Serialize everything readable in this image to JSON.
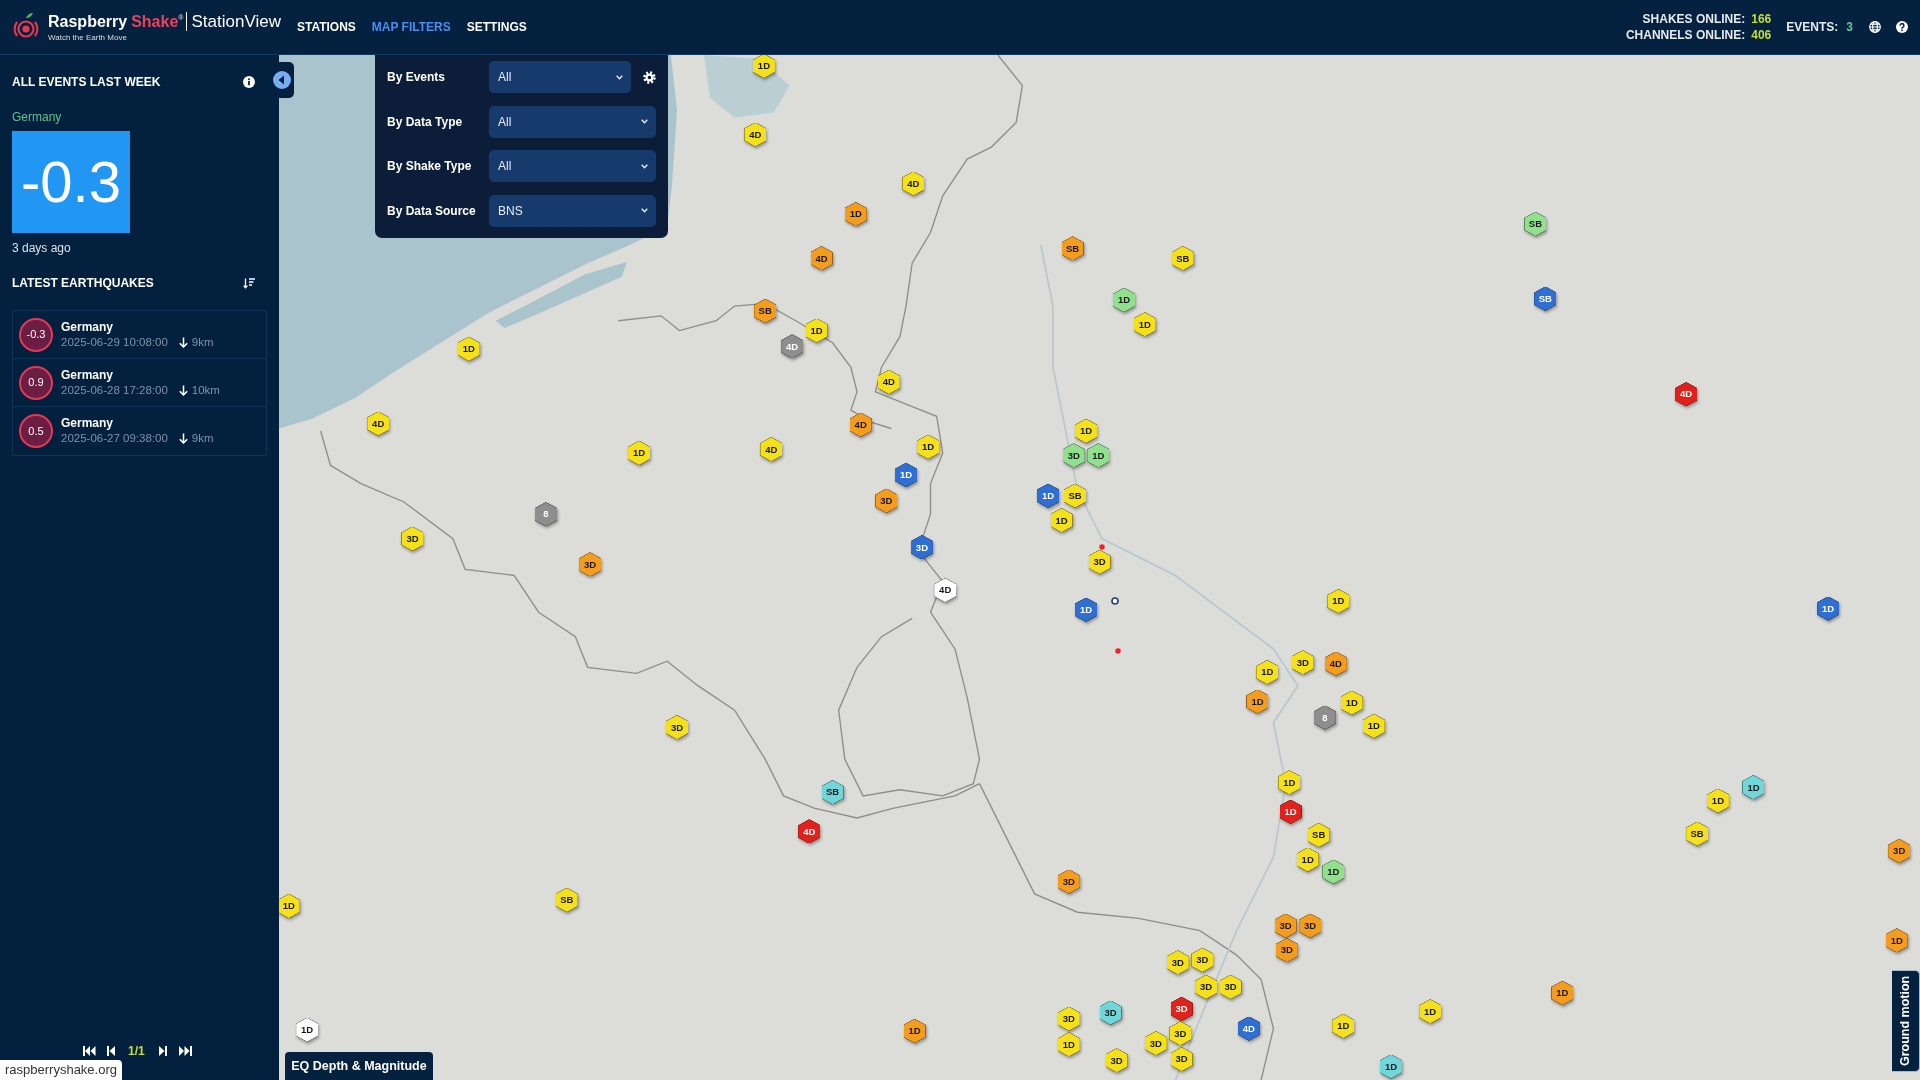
{
  "header": {
    "logo": {
      "brand": "Raspberry",
      "brand_accent": "Shake$^{®}$",
      "product": "StationView",
      "tagline": "Watch the Earth Move"
    },
    "nav": [
      {
        "label": "STATIONS",
        "selected": false
      },
      {
        "label": "MAP FILTERS",
        "selected": true
      },
      {
        "label": "SETTINGS",
        "selected": false
      }
    ],
    "stats": [
      {
        "label": "SHAKES ONLINE:",
        "value": "166"
      },
      {
        "label": "CHANNELS ONLINE:",
        "value": "406"
      }
    ],
    "events": {
      "label": "EVENTS:",
      "value": "3"
    }
  },
  "sidebar": {
    "title": "ALL EVENTS LAST WEEK",
    "featured": {
      "region": "Germany",
      "magnitude": "-0.3",
      "time_ago": "3 days ago"
    },
    "list_title": "LATEST EARTHQUAKES",
    "earthquakes": [
      {
        "magnitude": "-0.3",
        "region": "Germany",
        "time": "2025-06-29 10:08:00",
        "depth": "9km"
      },
      {
        "magnitude": "0.9",
        "region": "Germany",
        "time": "2025-06-28 17:28:00",
        "depth": "10km"
      },
      {
        "magnitude": "0.5",
        "region": "Germany",
        "time": "2025-06-27 09:38:00",
        "depth": "9km"
      }
    ],
    "pagination": {
      "page": "1/1"
    },
    "site_link": "raspberryshake.org"
  },
  "filters": [
    {
      "label": "By Events",
      "value": "All",
      "settings": true
    },
    {
      "label": "By Data Type",
      "value": "All",
      "settings": false
    },
    {
      "label": "By Shake Type",
      "value": "All",
      "settings": false
    },
    {
      "label": "By Data Source",
      "value": "BNS",
      "settings": false
    }
  ],
  "map": {
    "markers": [
      {
        "label": "1D",
        "color": "#f5e11b"
      },
      {
        "label": "4D",
        "color": "#f5e11b"
      },
      {
        "label": "4D",
        "color": "#f5e11b"
      },
      {
        "label": "1D",
        "color": "#f39c1e"
      },
      {
        "label": "4D",
        "color": "#f39c1e"
      },
      {
        "label": "SB",
        "color": "#f39c1e"
      },
      {
        "label": "SB",
        "color": "#f5e11b"
      },
      {
        "label": "SB",
        "color": "#90e08d"
      },
      {
        "label": "SB",
        "color": "#2f6fd4"
      },
      {
        "label": "1D",
        "color": "#90e08d"
      },
      {
        "label": "1D",
        "color": "#f5e11b"
      },
      {
        "label": "SB",
        "color": "#f39c1e"
      },
      {
        "label": "1D",
        "color": "#f5e11b"
      },
      {
        "label": "4D",
        "color": "#8e8e8e"
      },
      {
        "label": "1D",
        "color": "#f5e11b"
      },
      {
        "label": "4D",
        "color": "#e3211c"
      },
      {
        "label": "4D",
        "color": "#f5e11b"
      },
      {
        "label": "4D",
        "color": "#f5e11b"
      },
      {
        "label": "4D",
        "color": "#f39c1e"
      },
      {
        "label": "1D",
        "color": "#f5e11b"
      },
      {
        "label": "4D",
        "color": "#f5e11b"
      },
      {
        "label": "1D",
        "color": "#f5e11b"
      },
      {
        "label": "1D",
        "color": "#f5e11b"
      },
      {
        "label": "3D",
        "color": "#90e08d"
      },
      {
        "label": "1D",
        "color": "#90e08d"
      },
      {
        "label": "1D",
        "color": "#2f6fd4"
      },
      {
        "label": "3D",
        "color": "#f39c1e"
      },
      {
        "label": "1D",
        "color": "#2f6fd4"
      },
      {
        "label": "SB",
        "color": "#f5e11b"
      },
      {
        "label": "1D",
        "color": "#f5e11b"
      },
      {
        "label": "8",
        "color": "#8e8e8e"
      },
      {
        "label": "3D",
        "color": "#f5e11b"
      },
      {
        "label": "3D",
        "color": "#2f6fd4"
      },
      {
        "label": "3D",
        "color": "#f39c1e"
      },
      {
        "label": "3D",
        "color": "#f5e11b"
      },
      {
        "label": "4D",
        "color": "#ffffff"
      },
      {
        "label": "1D",
        "color": "#2f6fd4"
      },
      {
        "label": "1D",
        "color": "#f5e11b"
      },
      {
        "label": "1D",
        "color": "#2f6fd4"
      },
      {
        "label": "3D",
        "color": "#f5e11b"
      },
      {
        "label": "4D",
        "color": "#f39c1e"
      },
      {
        "label": "1D",
        "color": "#f5e11b"
      },
      {
        "label": "1D",
        "color": "#f39c1e"
      },
      {
        "label": "8",
        "color": "#8e8e8e"
      },
      {
        "label": "1D",
        "color": "#f5e11b"
      },
      {
        "label": "1D",
        "color": "#f5e11b"
      },
      {
        "label": "3D",
        "color": "#f5e11b"
      },
      {
        "label": "SB",
        "color": "#6fd7da"
      },
      {
        "label": "1D",
        "color": "#f5e11b"
      },
      {
        "label": "4D",
        "color": "#e3211c"
      },
      {
        "label": "1D",
        "color": "#e3211c"
      },
      {
        "label": "SB",
        "color": "#f5e11b"
      },
      {
        "label": "1D",
        "color": "#f5e11b"
      },
      {
        "label": "1D",
        "color": "#90e08d"
      },
      {
        "label": "1D",
        "color": "#6fd7da"
      },
      {
        "label": "1D",
        "color": "#f5e11b"
      },
      {
        "label": "SB",
        "color": "#f5e11b"
      },
      {
        "label": "3D",
        "color": "#f39c1e"
      },
      {
        "label": "1D",
        "color": "#f5e11b"
      },
      {
        "label": "SB",
        "color": "#f5e11b"
      },
      {
        "label": "3D",
        "color": "#f39c1e"
      },
      {
        "label": "3D",
        "color": "#f39c1e"
      },
      {
        "label": "3D",
        "color": "#f39c1e"
      },
      {
        "label": "3D",
        "color": "#f39c1e"
      },
      {
        "label": "1D",
        "color": "#f39c1e"
      },
      {
        "label": "3D",
        "color": "#f5e11b"
      },
      {
        "label": "3D",
        "color": "#f5e11b"
      },
      {
        "label": "3D",
        "color": "#f5e11b"
      },
      {
        "label": "3D",
        "color": "#f5e11b"
      },
      {
        "label": "3D",
        "color": "#e3211c"
      },
      {
        "label": "1D",
        "color": "#f39c1e"
      },
      {
        "label": "3D",
        "color": "#6fd7da"
      },
      {
        "label": "3D",
        "color": "#f5e11b"
      },
      {
        "label": "1D",
        "color": "#f5e11b"
      },
      {
        "label": "4D",
        "color": "#2f6fd4"
      },
      {
        "label": "1D",
        "color": "#f5e11b"
      },
      {
        "label": "1D",
        "color": "#f39c1e"
      },
      {
        "label": "3D",
        "color": "#f5e11b"
      },
      {
        "label": "3D",
        "color": "#f5e11b"
      },
      {
        "label": "1D",
        "color": "#f5e11b"
      },
      {
        "label": "1D",
        "color": "#ffffff"
      },
      {
        "label": "3D",
        "color": "#f5e11b"
      },
      {
        "label": "3D",
        "color": "#f5e11b"
      },
      {
        "label": "1D",
        "color": "#6fd7da"
      }
    ]
  },
  "buttons": {
    "depth_magnitude": "EQ Depth & Magnitude",
    "ground_motion": "Ground motion"
  }
}
